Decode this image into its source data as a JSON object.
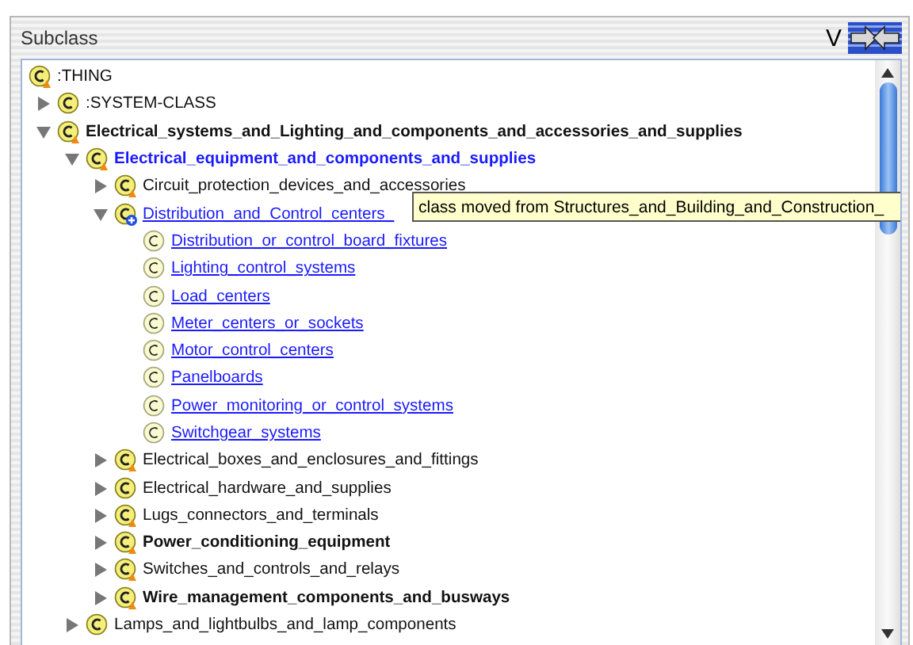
{
  "panel": {
    "title": "Subclass",
    "view_label": "V"
  },
  "tree": [
    {
      "label": ":THING",
      "kind": "plain",
      "locked": true,
      "children": [
        {
          "label": ":SYSTEM-CLASS",
          "kind": "plain",
          "locked": false,
          "expanded": false
        },
        {
          "label": "Electrical_systems_and_Lighting_and_components_and_accessories_and_supplies",
          "kind": "bold",
          "locked": true,
          "expanded": true,
          "children": [
            {
              "label": "Electrical_equipment_and_components_and_supplies",
              "kind": "current",
              "locked": true,
              "expanded": true,
              "children": [
                {
                  "label": "Circuit_protection_devices_and_accessories",
                  "kind": "plain",
                  "locked": true,
                  "expanded": false
                },
                {
                  "label": "Distribution_and_Control_centers_",
                  "kind": "link",
                  "added": true,
                  "expanded": true,
                  "children": [
                    {
                      "label": "Distribution_or_control_board_fixtures",
                      "kind": "link"
                    },
                    {
                      "label": "Lighting_control_systems",
                      "kind": "link"
                    },
                    {
                      "label": "Load_centers",
                      "kind": "link"
                    },
                    {
                      "label": "Meter_centers_or_sockets",
                      "kind": "link"
                    },
                    {
                      "label": "Motor_control_centers",
                      "kind": "link"
                    },
                    {
                      "label": "Panelboards",
                      "kind": "link"
                    },
                    {
                      "label": "Power_monitoring_or_control_systems",
                      "kind": "link"
                    },
                    {
                      "label": "Switchgear_systems",
                      "kind": "link"
                    }
                  ]
                },
                {
                  "label": "Electrical_boxes_and_enclosures_and_fittings",
                  "kind": "plain",
                  "locked": true,
                  "expanded": false
                },
                {
                  "label": "Electrical_hardware_and_supplies",
                  "kind": "plain",
                  "locked": false,
                  "expanded": false
                },
                {
                  "label": "Lugs_connectors_and_terminals",
                  "kind": "plain",
                  "locked": true,
                  "expanded": false
                },
                {
                  "label": "Power_conditioning_equipment",
                  "kind": "bold",
                  "locked": true,
                  "expanded": false
                },
                {
                  "label": "Switches_and_controls_and_relays",
                  "kind": "plain",
                  "locked": true,
                  "expanded": false
                },
                {
                  "label": "Wire_management_components_and_busways",
                  "kind": "bold",
                  "locked": true,
                  "expanded": false
                }
              ]
            },
            {
              "label": "Lamps_and_lightbulbs_and_lamp_components",
              "kind": "plain",
              "locked": false,
              "expanded": false
            }
          ]
        }
      ]
    }
  ],
  "tooltip": {
    "text": "class moved from Structures_and_Building_and_Construction_"
  }
}
